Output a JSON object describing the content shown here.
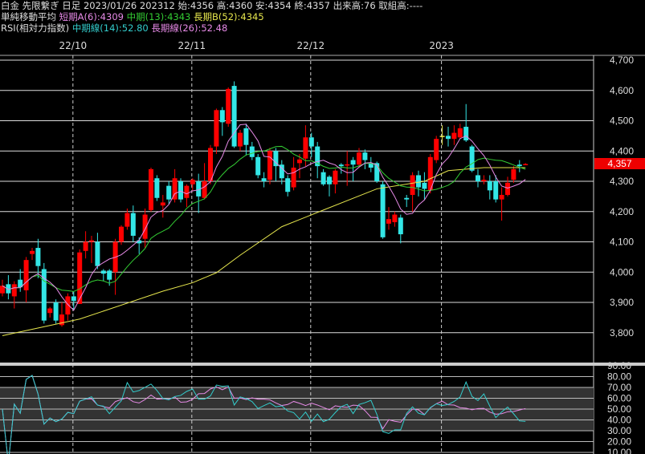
{
  "header": {
    "line1": "白金 先限繋ぎ 日足 2023/01/26 202312 始:4356 高:4360 安:4354 終:4357 出来高:76 取組高:----",
    "ma_title": "単純移動平均",
    "ma_short": "短期A(6):4309",
    "ma_mid": "中期(13):4343",
    "ma_long": "長期B(52):4345",
    "rsi_title": "RSI(相対力指数)",
    "rsi_mid": "中期線(14):52.80",
    "rsi_long": "長期線(26):52.48"
  },
  "colors": {
    "up": "#ff0000",
    "down": "#33e6e6",
    "ma_short": "#e68ae6",
    "ma_mid": "#33cc33",
    "ma_long": "#e6e64d",
    "rsi_mid": "#33cccc",
    "rsi_long": "#e68ae6",
    "current_price_bg": "#e00000"
  },
  "current_price": "4,357",
  "chart_data": {
    "type": "candlestick",
    "date_labels": [
      {
        "label": "22/10",
        "index": 12
      },
      {
        "label": "22/11",
        "index": 32
      },
      {
        "label": "22/12",
        "index": 52
      },
      {
        "label": "2023",
        "index": 74
      }
    ],
    "price_axis": {
      "ylim": [
        3720,
        4720
      ],
      "ticks": [
        "4,700",
        "4,600",
        "4,500",
        "4,400",
        "4,300",
        "4,200",
        "4,100",
        "4,000",
        "3,900",
        "3,800"
      ],
      "tick_values": [
        4700,
        4600,
        4500,
        4400,
        4300,
        4200,
        4100,
        4000,
        3900,
        3800
      ]
    },
    "rsi_axis": {
      "ylim": [
        5,
        93
      ],
      "ticks": [
        "90.00",
        "80.00",
        "70.00",
        "60.00",
        "50.00",
        "40.00",
        "30.00",
        "20.00",
        "10.00"
      ],
      "tick_values": [
        90,
        80,
        70,
        60,
        50,
        40,
        30,
        20,
        10
      ],
      "band": [
        30,
        70
      ]
    },
    "ohlc": [
      [
        3930,
        3975,
        3920,
        3955
      ],
      [
        3960,
        3990,
        3910,
        3930
      ],
      [
        3920,
        3970,
        3880,
        3960
      ],
      [
        3975,
        4010,
        3935,
        3950
      ],
      [
        3940,
        4050,
        3900,
        4040
      ],
      [
        4060,
        4080,
        4040,
        4070
      ],
      [
        4080,
        4110,
        3980,
        4020
      ],
      [
        4010,
        4030,
        3830,
        3840
      ],
      [
        3865,
        3885,
        3850,
        3880
      ],
      [
        3900,
        3910,
        3830,
        3840
      ],
      [
        3825,
        3900,
        3820,
        3860
      ],
      [
        3860,
        3930,
        3840,
        3920
      ],
      [
        3920,
        3935,
        3875,
        3905
      ],
      [
        3895,
        4075,
        3895,
        4065
      ],
      [
        4070,
        4135,
        4045,
        4100
      ],
      [
        4100,
        4120,
        4030,
        4105
      ],
      [
        4100,
        4130,
        4010,
        4020
      ],
      [
        4005,
        4010,
        3970,
        3995
      ],
      [
        4005,
        4010,
        3955,
        3975
      ],
      [
        4000,
        4110,
        3925,
        4100
      ],
      [
        4100,
        4155,
        4090,
        4150
      ],
      [
        4150,
        4210,
        4140,
        4195
      ],
      [
        4195,
        4220,
        4100,
        4120
      ],
      [
        4105,
        4115,
        4060,
        4095
      ],
      [
        4110,
        4210,
        4080,
        4190
      ],
      [
        4205,
        4345,
        4200,
        4340
      ],
      [
        4310,
        4320,
        4235,
        4245
      ],
      [
        4220,
        4255,
        4180,
        4230
      ],
      [
        4285,
        4300,
        4225,
        4240
      ],
      [
        4240,
        4340,
        4230,
        4310
      ],
      [
        4300,
        4310,
        4230,
        4240
      ],
      [
        4245,
        4290,
        4215,
        4285
      ],
      [
        4290,
        4310,
        4270,
        4305
      ],
      [
        4300,
        4325,
        4195,
        4250
      ],
      [
        4245,
        4360,
        4240,
        4300
      ],
      [
        4300,
        4420,
        4290,
        4410
      ],
      [
        4415,
        4540,
        4390,
        4535
      ],
      [
        4535,
        4545,
        4450,
        4495
      ],
      [
        4490,
        4610,
        4480,
        4605
      ],
      [
        4615,
        4630,
        4410,
        4415
      ],
      [
        4415,
        4470,
        4400,
        4460
      ],
      [
        4475,
        4490,
        4385,
        4420
      ],
      [
        4415,
        4430,
        4370,
        4380
      ],
      [
        4380,
        4390,
        4310,
        4320
      ],
      [
        4310,
        4330,
        4280,
        4300
      ],
      [
        4305,
        4410,
        4290,
        4400
      ],
      [
        4400,
        4410,
        4300,
        4350
      ],
      [
        4355,
        4370,
        4290,
        4310
      ],
      [
        4310,
        4320,
        4250,
        4265
      ],
      [
        4280,
        4380,
        4270,
        4345
      ],
      [
        4360,
        4390,
        4310,
        4372
      ],
      [
        4375,
        4485,
        4350,
        4445
      ],
      [
        4445,
        4460,
        4380,
        4415
      ],
      [
        4415,
        4430,
        4310,
        4350
      ],
      [
        4330,
        4340,
        4285,
        4290
      ],
      [
        4315,
        4320,
        4250,
        4290
      ],
      [
        4290,
        4340,
        4260,
        4335
      ],
      [
        4355,
        4360,
        4325,
        4350
      ],
      [
        4352,
        4400,
        4285,
        4356
      ],
      [
        4370,
        4380,
        4300,
        4355
      ],
      [
        4355,
        4410,
        4345,
        4395
      ],
      [
        4395,
        4405,
        4340,
        4370
      ],
      [
        4360,
        4380,
        4330,
        4345
      ],
      [
        4360,
        4365,
        4295,
        4300
      ],
      [
        4290,
        4300,
        4110,
        4115
      ],
      [
        4160,
        4215,
        4140,
        4175
      ],
      [
        4165,
        4200,
        4150,
        4190
      ],
      [
        4180,
        4190,
        4095,
        4125
      ],
      [
        4245,
        4255,
        4215,
        4240
      ],
      [
        4255,
        4330,
        4200,
        4320
      ],
      [
        4320,
        4335,
        4250,
        4280
      ],
      [
        4295,
        4330,
        4240,
        4275
      ],
      [
        4270,
        4390,
        4260,
        4380
      ],
      [
        4370,
        4450,
        4360,
        4440
      ],
      [
        4450,
        4485,
        4420,
        4450
      ],
      [
        4450,
        4480,
        4415,
        4440
      ],
      [
        4440,
        4485,
        4420,
        4460
      ],
      [
        4445,
        4490,
        4440,
        4475
      ],
      [
        4480,
        4555,
        4430,
        4435
      ],
      [
        4415,
        4420,
        4330,
        4335
      ],
      [
        4320,
        4340,
        4280,
        4300
      ],
      [
        4300,
        4320,
        4290,
        4305
      ],
      [
        4300,
        4320,
        4240,
        4270
      ],
      [
        4300,
        4320,
        4230,
        4240
      ],
      [
        4240,
        4280,
        4170,
        4255
      ],
      [
        4255,
        4315,
        4250,
        4295
      ],
      [
        4305,
        4350,
        4295,
        4340
      ],
      [
        4355,
        4370,
        4330,
        4350
      ],
      [
        4356,
        4360,
        4354,
        4357
      ]
    ],
    "ma_long_points": [
      [
        0,
        3790
      ],
      [
        13,
        3845
      ],
      [
        27,
        3937
      ],
      [
        32,
        3965
      ],
      [
        36,
        3998
      ],
      [
        40,
        4056
      ],
      [
        47,
        4150
      ],
      [
        54,
        4205
      ],
      [
        63,
        4275
      ],
      [
        71,
        4300
      ],
      [
        75,
        4335
      ],
      [
        81,
        4345
      ],
      [
        88,
        4345
      ]
    ]
  }
}
